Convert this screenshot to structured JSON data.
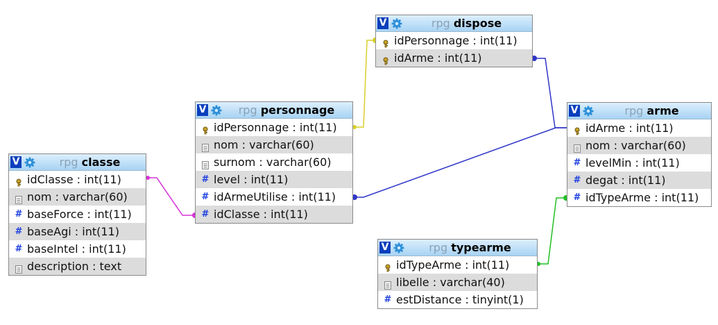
{
  "tables": [
    {
      "id": "classe",
      "db": "rpg",
      "name": "classe",
      "columns": [
        {
          "text": "idClasse : int(11)",
          "icon": "key"
        },
        {
          "text": "nom : varchar(60)",
          "icon": "text"
        },
        {
          "text": "baseForce : int(11)",
          "icon": "hash"
        },
        {
          "text": "baseAgi : int(11)",
          "icon": "hash"
        },
        {
          "text": "baseIntel : int(11)",
          "icon": "hash"
        },
        {
          "text": "description : text",
          "icon": "text"
        }
      ]
    },
    {
      "id": "personnage",
      "db": "rpg",
      "name": "personnage",
      "columns": [
        {
          "text": "idPersonnage : int(11)",
          "icon": "key"
        },
        {
          "text": "nom : varchar(60)",
          "icon": "text"
        },
        {
          "text": "surnom : varchar(60)",
          "icon": "text"
        },
        {
          "text": "level : int(11)",
          "icon": "hash"
        },
        {
          "text": "idArmeUtilise : int(11)",
          "icon": "hash"
        },
        {
          "text": "idClasse : int(11)",
          "icon": "hash"
        }
      ]
    },
    {
      "id": "dispose",
      "db": "rpg",
      "name": "dispose",
      "columns": [
        {
          "text": "idPersonnage : int(11)",
          "icon": "key"
        },
        {
          "text": "idArme : int(11)",
          "icon": "key"
        }
      ]
    },
    {
      "id": "arme",
      "db": "rpg",
      "name": "arme",
      "columns": [
        {
          "text": "idArme : int(11)",
          "icon": "key"
        },
        {
          "text": "nom : varchar(60)",
          "icon": "text"
        },
        {
          "text": "levelMin : int(11)",
          "icon": "hash"
        },
        {
          "text": "degat : int(11)",
          "icon": "hash"
        },
        {
          "text": "idTypeArme : int(11)",
          "icon": "hash"
        }
      ]
    },
    {
      "id": "typearme",
      "db": "rpg",
      "name": "typearme",
      "columns": [
        {
          "text": "idTypeArme : int(11)",
          "icon": "key"
        },
        {
          "text": "libelle : varchar(40)",
          "icon": "text"
        },
        {
          "text": "estDistance : tinyint(1)",
          "icon": "hash"
        }
      ]
    }
  ],
  "header_icons": [
    "v-toggle-icon",
    "gear-icon"
  ],
  "colors": {
    "classe_personnage": "#d633d6",
    "personnage_dispose": "#d9cf2a",
    "dispose_arme": "#2f35c7",
    "personnage_arme": "#2f35c7",
    "typearme_arme": "#22c022",
    "header_top": "#ddeffd",
    "header_bottom": "#a7d3f3"
  }
}
